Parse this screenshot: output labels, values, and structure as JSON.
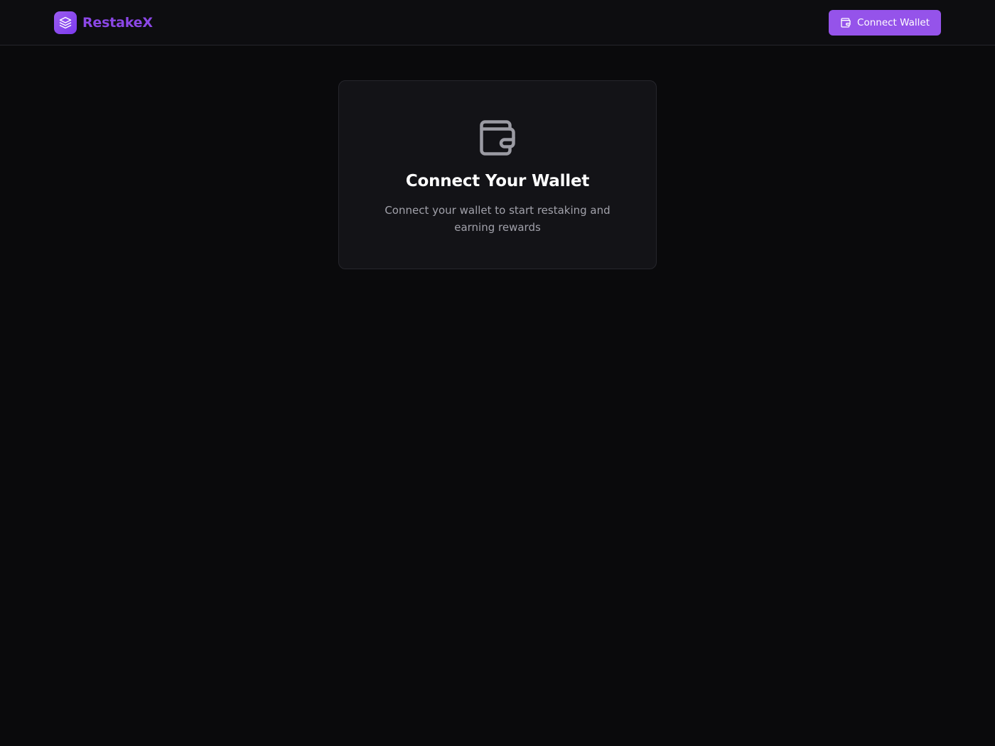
{
  "header": {
    "brand_name": "RestakeX",
    "brand_icon": "layers-icon",
    "connect_button_label": "Connect Wallet",
    "connect_button_icon": "wallet-icon"
  },
  "main": {
    "card": {
      "icon": "wallet-icon",
      "title": "Connect Your Wallet",
      "description": "Connect your wallet to start restaking and earning rewards"
    }
  },
  "colors": {
    "background": "#0a0a0c",
    "accent": "#9553ea",
    "brand_text": "#8b47e6",
    "card_background": "#131317",
    "muted_text": "#a1a1aa"
  }
}
